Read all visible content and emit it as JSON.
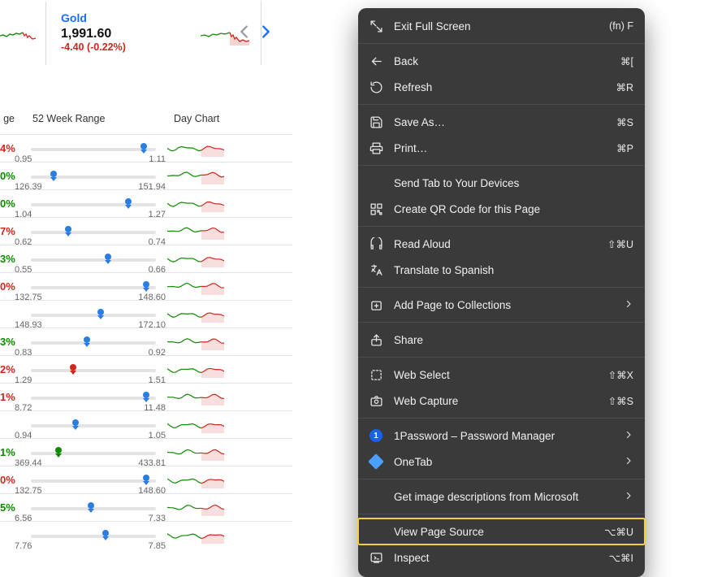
{
  "ticker": {
    "name": "Gold",
    "price": "1,991.60",
    "change": "-4.40 (-0.22%)"
  },
  "headers": {
    "pct": "ge",
    "range": "52 Week Range",
    "chart": "Day Chart"
  },
  "rows": [
    {
      "pct_text": "4%",
      "pct_color": "red",
      "low": "0.95",
      "high": "1.11",
      "mark": 0.9,
      "mark_color": "blue"
    },
    {
      "pct_text": "0%",
      "pct_color": "green",
      "low": "126.39",
      "high": "151.94",
      "mark": 0.18,
      "mark_color": "blue"
    },
    {
      "pct_text": "0%",
      "pct_color": "green",
      "low": "1.04",
      "high": "1.27",
      "mark": 0.78,
      "mark_color": "blue"
    },
    {
      "pct_text": "7%",
      "pct_color": "red",
      "low": "0.62",
      "high": "0.74",
      "mark": 0.3,
      "mark_color": "blue"
    },
    {
      "pct_text": "3%",
      "pct_color": "green",
      "low": "0.55",
      "high": "0.66",
      "mark": 0.62,
      "mark_color": "blue"
    },
    {
      "pct_text": "0%",
      "pct_color": "red",
      "low": "132.75",
      "high": "148.60",
      "mark": 0.92,
      "mark_color": "blue"
    },
    {
      "pct_text": "",
      "pct_color": "",
      "low": "148.93",
      "high": "172.10",
      "mark": 0.56,
      "mark_color": "blue"
    },
    {
      "pct_text": "3%",
      "pct_color": "green",
      "low": "0.83",
      "high": "0.92",
      "mark": 0.45,
      "mark_color": "blue"
    },
    {
      "pct_text": "2%",
      "pct_color": "red",
      "low": "1.29",
      "high": "1.51",
      "mark": 0.34,
      "mark_color": "red"
    },
    {
      "pct_text": "1%",
      "pct_color": "red",
      "low": "8.72",
      "high": "11.48",
      "mark": 0.92,
      "mark_color": "blue"
    },
    {
      "pct_text": "",
      "pct_color": "",
      "low": "0.94",
      "high": "1.05",
      "mark": 0.36,
      "mark_color": "blue"
    },
    {
      "pct_text": "1%",
      "pct_color": "green",
      "low": "369.44",
      "high": "433.81",
      "mark": 0.22,
      "mark_color": "green"
    },
    {
      "pct_text": "0%",
      "pct_color": "red",
      "low": "132.75",
      "high": "148.60",
      "mark": 0.92,
      "mark_color": "blue"
    },
    {
      "pct_text": "5%",
      "pct_color": "green",
      "low": "6.56",
      "high": "7.33",
      "mark": 0.48,
      "mark_color": "blue"
    },
    {
      "pct_text": "",
      "pct_color": "",
      "low": "7.76",
      "high": "7.85",
      "mark": 0.6,
      "mark_color": "blue"
    }
  ],
  "menu": {
    "items": [
      {
        "icon": "exit-full",
        "label": "Exit Full Screen",
        "shortcut": "(fn) F"
      },
      {
        "sep": true
      },
      {
        "icon": "back",
        "label": "Back",
        "shortcut": "⌘["
      },
      {
        "icon": "refresh",
        "label": "Refresh",
        "shortcut": "⌘R"
      },
      {
        "sep": true
      },
      {
        "icon": "save",
        "label": "Save As…",
        "shortcut": "⌘S"
      },
      {
        "icon": "print",
        "label": "Print…",
        "shortcut": "⌘P"
      },
      {
        "sep": true
      },
      {
        "icon": "none",
        "label": "Send Tab to Your Devices"
      },
      {
        "icon": "qr",
        "label": "Create QR Code for this Page"
      },
      {
        "sep": true
      },
      {
        "icon": "read",
        "label": "Read Aloud",
        "shortcut": "⇧⌘U"
      },
      {
        "icon": "translate",
        "label": "Translate to Spanish"
      },
      {
        "sep": true
      },
      {
        "icon": "collections",
        "label": "Add Page to Collections",
        "sub": true
      },
      {
        "sep": true
      },
      {
        "icon": "share",
        "label": "Share"
      },
      {
        "sep": true
      },
      {
        "icon": "web-select",
        "label": "Web Select",
        "shortcut": "⇧⌘X"
      },
      {
        "icon": "web-capture",
        "label": "Web Capture",
        "shortcut": "⇧⌘S"
      },
      {
        "sep": true
      },
      {
        "icon": "onepass",
        "label": "1Password – Password Manager",
        "sub": true
      },
      {
        "icon": "onetab",
        "label": "OneTab",
        "sub": true
      },
      {
        "sep": true
      },
      {
        "icon": "none",
        "label": "Get image descriptions from Microsoft",
        "sub": true
      },
      {
        "sep": true
      },
      {
        "icon": "none",
        "label": "View Page Source",
        "shortcut": "⌥⌘U",
        "highlight": true
      },
      {
        "icon": "inspect",
        "label": "Inspect",
        "shortcut": "⌥⌘I"
      }
    ]
  }
}
